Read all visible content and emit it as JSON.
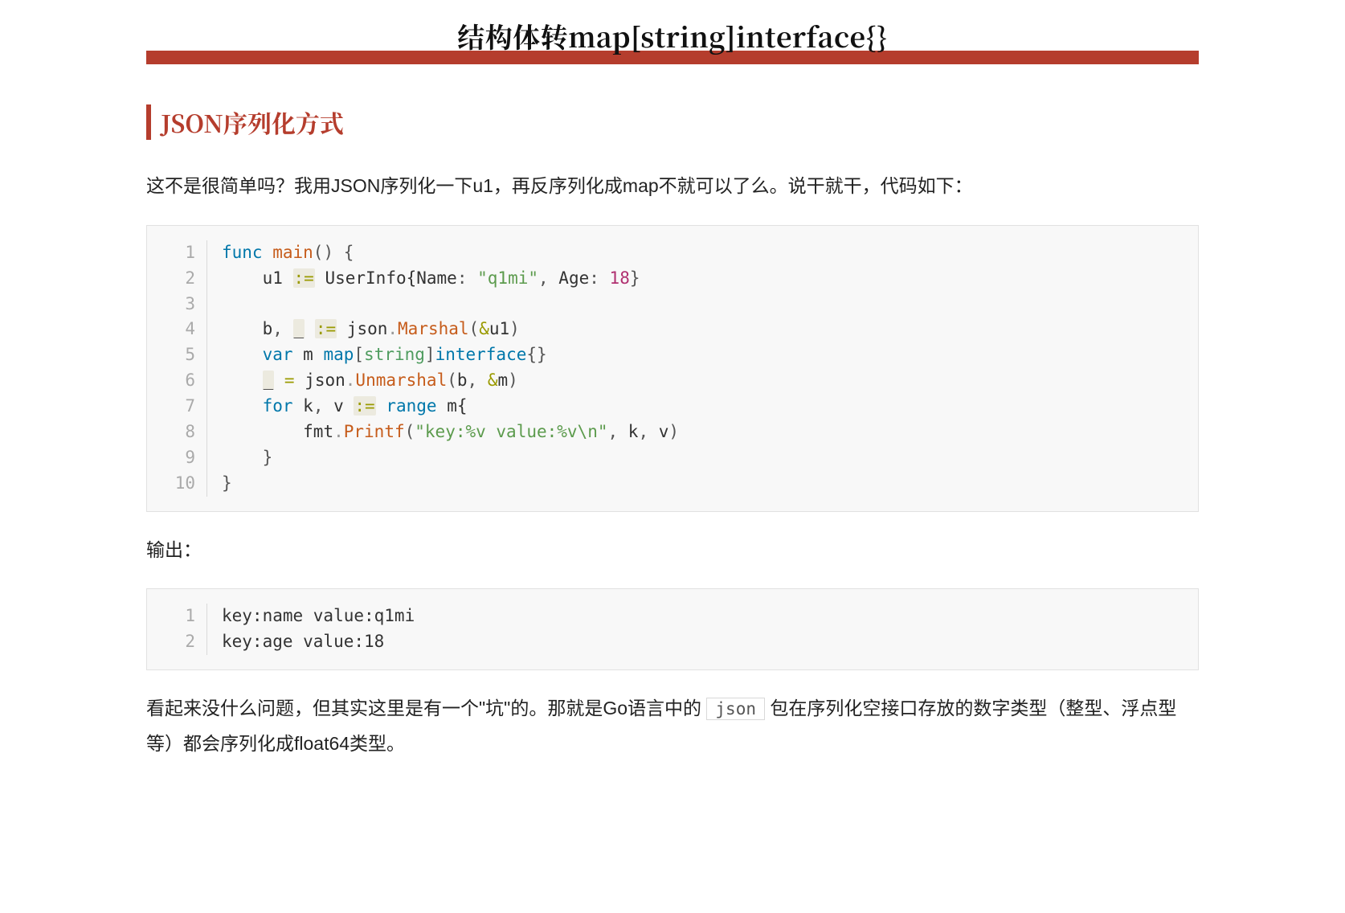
{
  "title": "结构体转map[string]interface{}",
  "section_heading": "JSON序列化方式",
  "para1": "这不是很简单吗？我用JSON序列化一下u1，再反序列化成map不就可以了么。说干就干，代码如下：",
  "code1": {
    "lines": [
      {
        "n": "1",
        "tokens": [
          {
            "t": "func ",
            "c": "tok-kw"
          },
          {
            "t": "main",
            "c": "tok-fn"
          },
          {
            "t": "()",
            "c": "tok-punct"
          },
          {
            "t": " {",
            "c": "tok-punct"
          }
        ]
      },
      {
        "n": "2",
        "tokens": [
          {
            "t": "    ",
            "c": ""
          },
          {
            "t": "u1 ",
            "c": "tok-id"
          },
          {
            "t": ":=",
            "c": "tok-op bg-op"
          },
          {
            "t": " UserInfo{Name",
            "c": "tok-id"
          },
          {
            "t": ":",
            "c": "tok-punct"
          },
          {
            "t": " ",
            "c": ""
          },
          {
            "t": "\"q1mi\"",
            "c": "tok-str"
          },
          {
            "t": ",",
            "c": "tok-punct"
          },
          {
            "t": " Age",
            "c": "tok-id"
          },
          {
            "t": ":",
            "c": "tok-punct"
          },
          {
            "t": " ",
            "c": ""
          },
          {
            "t": "18",
            "c": "tok-num"
          },
          {
            "t": "}",
            "c": "tok-punct"
          }
        ]
      },
      {
        "n": "3",
        "tokens": [
          {
            "t": "",
            "c": ""
          }
        ]
      },
      {
        "n": "4",
        "tokens": [
          {
            "t": "    ",
            "c": ""
          },
          {
            "t": "b",
            "c": "tok-id"
          },
          {
            "t": ",",
            "c": "tok-punct"
          },
          {
            "t": " ",
            "c": ""
          },
          {
            "t": "_",
            "c": "tok-id bg-op"
          },
          {
            "t": " ",
            "c": ""
          },
          {
            "t": ":=",
            "c": "tok-op bg-op"
          },
          {
            "t": " json",
            "c": "tok-id"
          },
          {
            "t": ".",
            "c": "tok-dot"
          },
          {
            "t": "Marshal",
            "c": "tok-fn"
          },
          {
            "t": "(",
            "c": "tok-punct"
          },
          {
            "t": "&",
            "c": "tok-op"
          },
          {
            "t": "u1",
            "c": "tok-id"
          },
          {
            "t": ")",
            "c": "tok-punct"
          }
        ]
      },
      {
        "n": "5",
        "tokens": [
          {
            "t": "    ",
            "c": ""
          },
          {
            "t": "var",
            "c": "tok-kw"
          },
          {
            "t": " m ",
            "c": "tok-id"
          },
          {
            "t": "map",
            "c": "tok-kw"
          },
          {
            "t": "[",
            "c": "tok-punct"
          },
          {
            "t": "string",
            "c": "tok-type"
          },
          {
            "t": "]",
            "c": "tok-punct"
          },
          {
            "t": "interface",
            "c": "tok-kw"
          },
          {
            "t": "{}",
            "c": "tok-punct"
          }
        ]
      },
      {
        "n": "6",
        "tokens": [
          {
            "t": "    ",
            "c": ""
          },
          {
            "t": "_",
            "c": "tok-id bg-op"
          },
          {
            "t": " ",
            "c": ""
          },
          {
            "t": "=",
            "c": "tok-op"
          },
          {
            "t": " json",
            "c": "tok-id"
          },
          {
            "t": ".",
            "c": "tok-dot"
          },
          {
            "t": "Unmarshal",
            "c": "tok-fn"
          },
          {
            "t": "(",
            "c": "tok-punct"
          },
          {
            "t": "b",
            "c": "tok-id"
          },
          {
            "t": ",",
            "c": "tok-punct"
          },
          {
            "t": " ",
            "c": ""
          },
          {
            "t": "&",
            "c": "tok-op"
          },
          {
            "t": "m",
            "c": "tok-id"
          },
          {
            "t": ")",
            "c": "tok-punct"
          }
        ]
      },
      {
        "n": "7",
        "tokens": [
          {
            "t": "    ",
            "c": ""
          },
          {
            "t": "for",
            "c": "tok-kw"
          },
          {
            "t": " k",
            "c": "tok-id"
          },
          {
            "t": ",",
            "c": "tok-punct"
          },
          {
            "t": " v ",
            "c": "tok-id"
          },
          {
            "t": ":=",
            "c": "tok-op bg-op"
          },
          {
            "t": " ",
            "c": ""
          },
          {
            "t": "range",
            "c": "tok-kw"
          },
          {
            "t": " m{",
            "c": "tok-id"
          }
        ]
      },
      {
        "n": "8",
        "tokens": [
          {
            "t": "        ",
            "c": ""
          },
          {
            "t": "fmt",
            "c": "tok-id"
          },
          {
            "t": ".",
            "c": "tok-dot"
          },
          {
            "t": "Printf",
            "c": "tok-fn"
          },
          {
            "t": "(",
            "c": "tok-punct"
          },
          {
            "t": "\"key:%v value:%v\\n\"",
            "c": "tok-str"
          },
          {
            "t": ",",
            "c": "tok-punct"
          },
          {
            "t": " k",
            "c": "tok-id"
          },
          {
            "t": ",",
            "c": "tok-punct"
          },
          {
            "t": " v",
            "c": "tok-id"
          },
          {
            "t": ")",
            "c": "tok-punct"
          }
        ]
      },
      {
        "n": "9",
        "tokens": [
          {
            "t": "    }",
            "c": "tok-punct"
          }
        ]
      },
      {
        "n": "10",
        "tokens": [
          {
            "t": "}",
            "c": "tok-punct"
          }
        ]
      }
    ]
  },
  "para2": "输出：",
  "code2": {
    "lines": [
      {
        "n": "1",
        "tokens": [
          {
            "t": "key:name value:q1mi",
            "c": "tok-id"
          }
        ]
      },
      {
        "n": "2",
        "tokens": [
          {
            "t": "key:age value:18",
            "c": "tok-id"
          }
        ]
      }
    ]
  },
  "para3_pre": "看起来没什么问题，但其实这里是有一个\"坑\"的。那就是Go语言中的 ",
  "para3_code": "json",
  "para3_post": " 包在序列化空接口存放的数字类型（整型、浮点型等）都会序列化成float64类型。"
}
